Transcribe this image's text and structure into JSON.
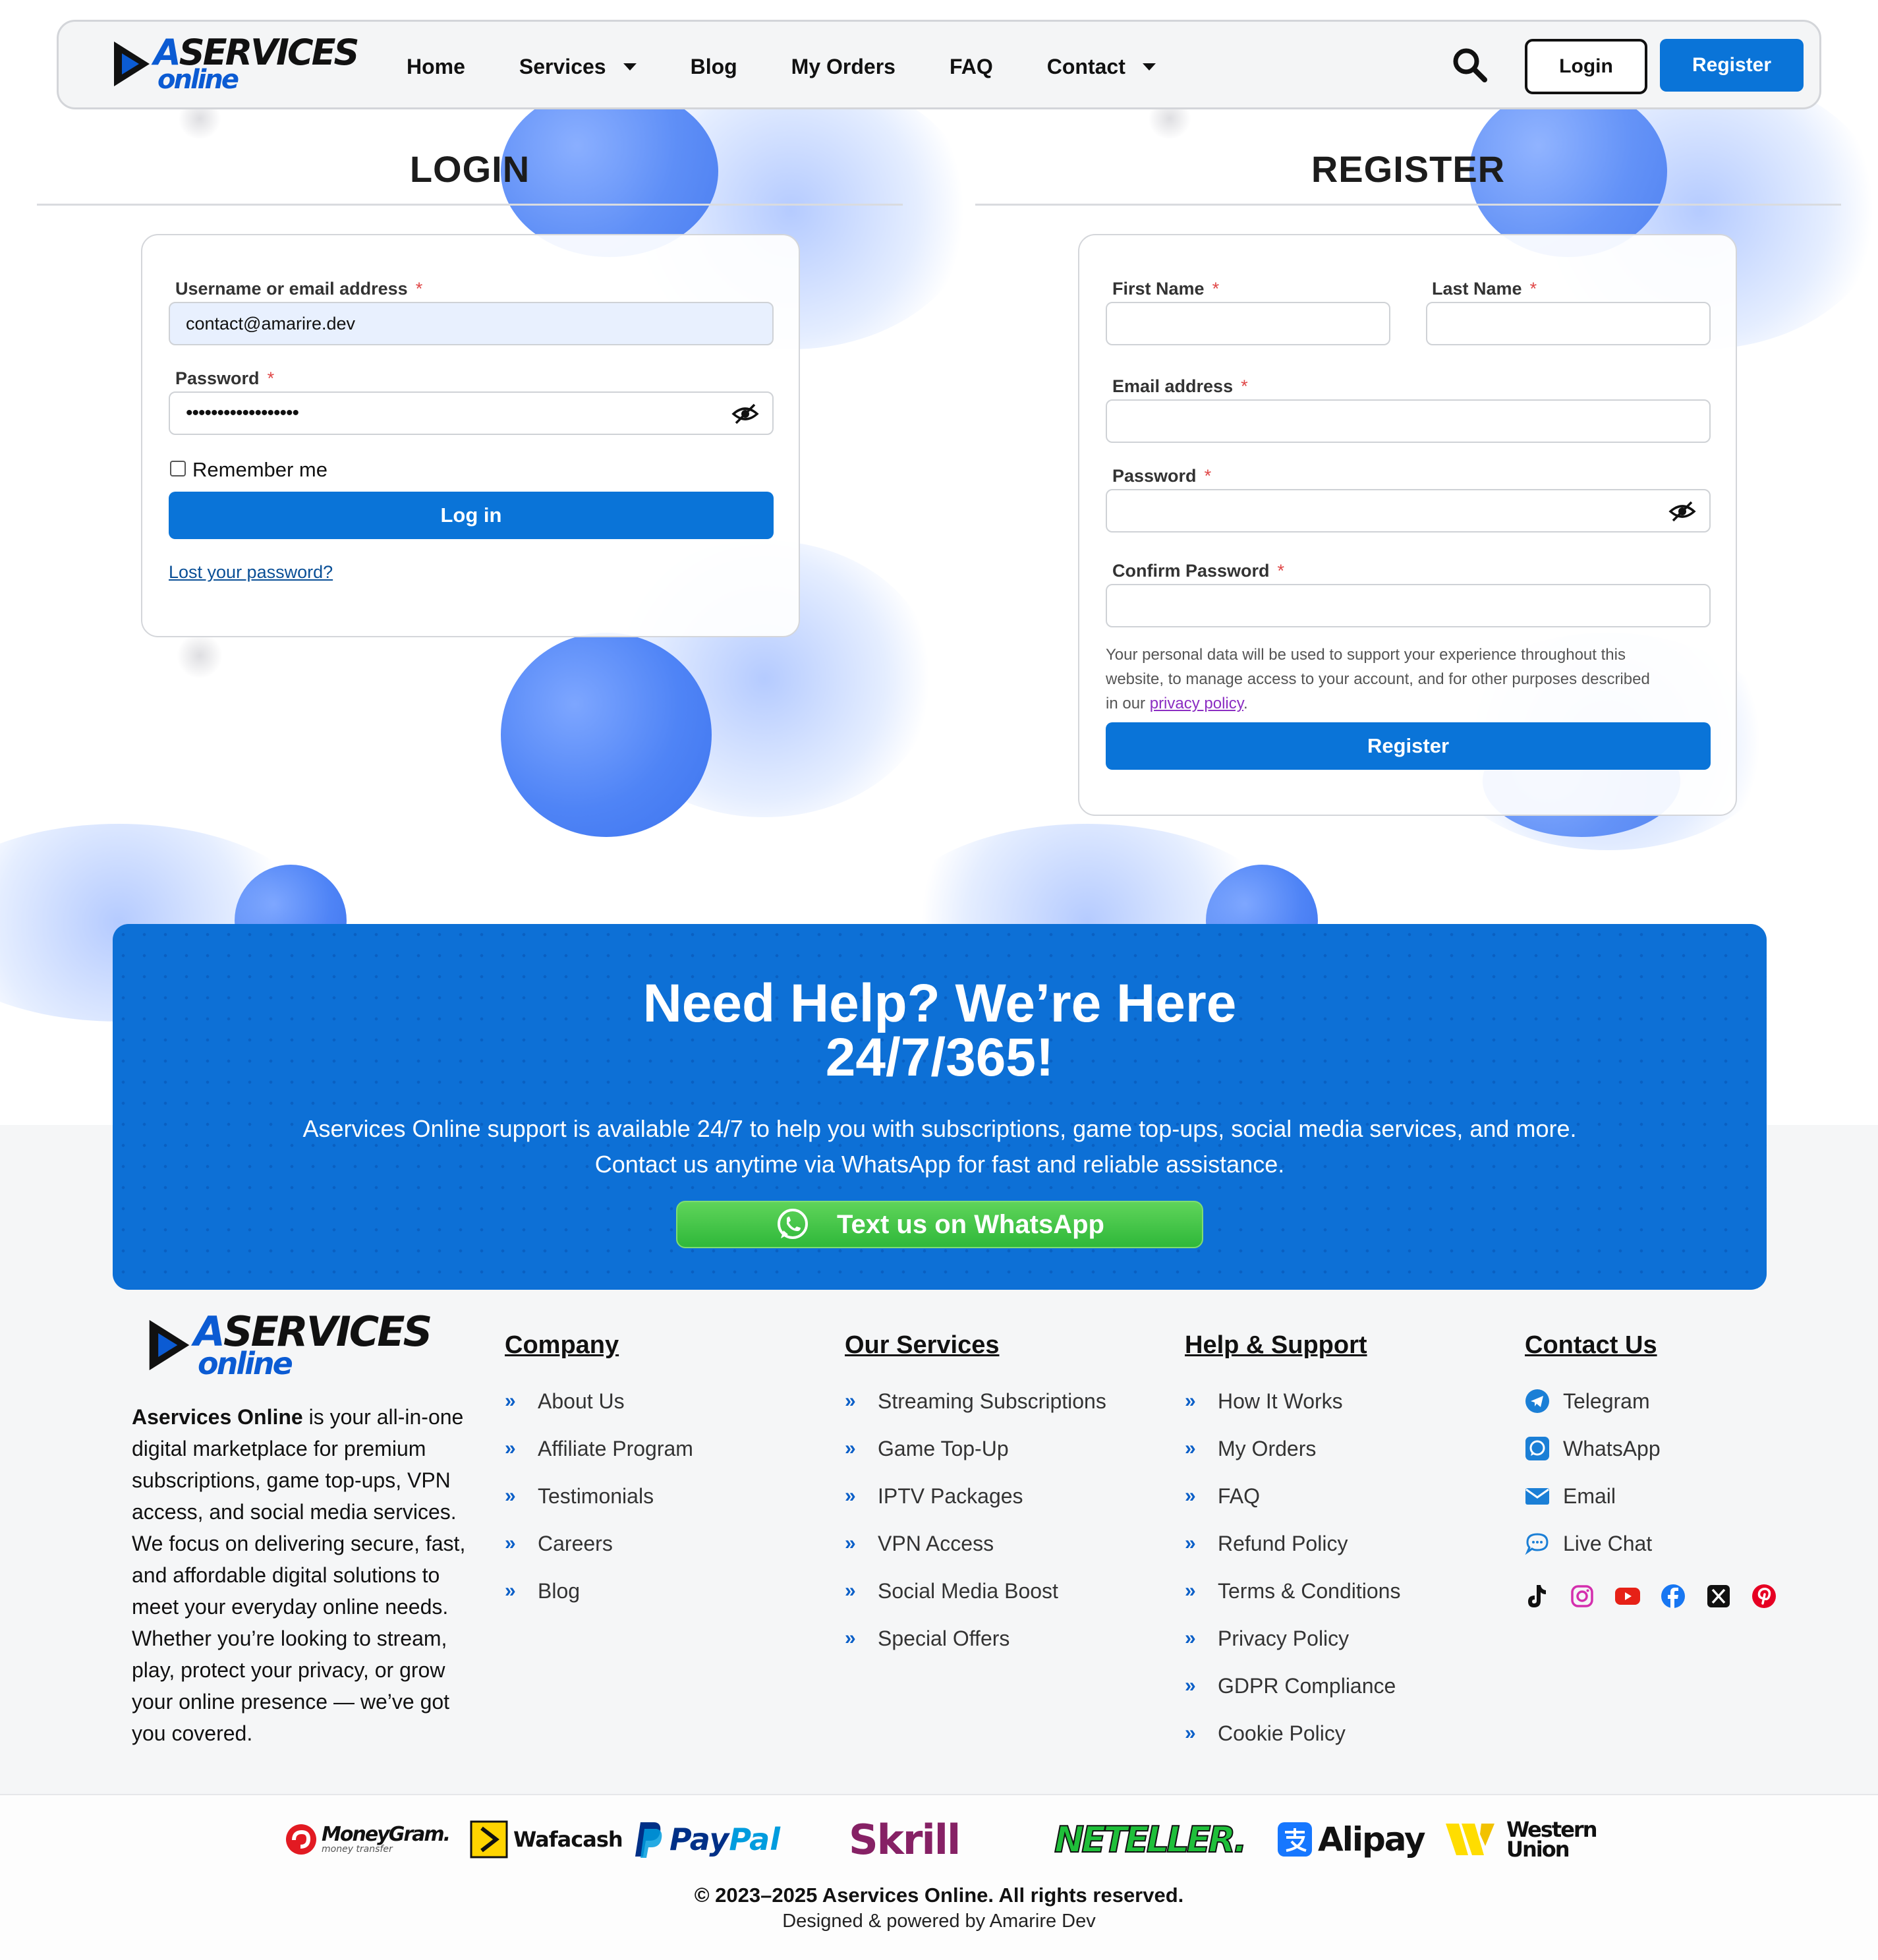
{
  "brand": {
    "logo_top": "SERVICES",
    "logo_initial": "A",
    "logo_bottom": "online",
    "primary_color": "#0a74d8",
    "whatsapp_color": "#3cc24a"
  },
  "header": {
    "nav": [
      {
        "label": "Home"
      },
      {
        "label": "Services"
      },
      {
        "label": "Blog"
      },
      {
        "label": "My Orders"
      },
      {
        "label": "FAQ"
      },
      {
        "label": "Contact"
      }
    ],
    "search_icon": "search-icon",
    "login_label": "Login",
    "register_label": "Register"
  },
  "login": {
    "title": "LOGIN",
    "username_label": "Username or email address",
    "username_value": "contact@amarire.dev",
    "password_label": "Password",
    "password_value": "••••••••••••••••••",
    "remember_label": "Remember me",
    "submit_label": "Log in",
    "lost_password": "Lost your password?"
  },
  "register": {
    "title": "REGISTER",
    "first_name_label": "First Name",
    "last_name_label": "Last Name",
    "email_label": "Email address",
    "password_label": "Password",
    "confirm_label": "Confirm Password",
    "privacy_text_1": "Your personal data will be used to support your experience throughout this",
    "privacy_text_2": "website, to manage access to your account, and for other purposes described",
    "privacy_text_3": "in our",
    "privacy_link": "privacy policy",
    "privacy_text_end": ".",
    "submit_label": "Register",
    "required_mark": "*"
  },
  "help": {
    "title_line1": "Need Help? We’re Here",
    "title_line2": "24/7/365!",
    "text_line1": "Aservices Online support is available 24/7 to help you with subscriptions, game top-ups, social media services, and more.",
    "text_line2": "Contact us anytime via WhatsApp for fast and reliable assistance.",
    "button_label": "Text us on WhatsApp"
  },
  "footer": {
    "about_bold": "Aservices Online",
    "about_text": " is your all-in-one digital marketplace for premium subscriptions, game top-ups, VPN access, and social media services. We focus on delivering secure, fast, and affordable digital solutions to meet your everyday online needs. Whether you’re looking to stream, play, protect your privacy, or grow your online presence — we’ve got you covered.",
    "company": {
      "title": "Company",
      "items": [
        "About Us",
        "Affiliate Program",
        "Testimonials",
        "Careers",
        "Blog"
      ]
    },
    "services": {
      "title": "Our Services",
      "items": [
        "Streaming Subscriptions",
        "Game Top-Up",
        "IPTV Packages",
        "VPN Access",
        "Social Media Boost",
        "Special Offers"
      ]
    },
    "support": {
      "title": "Help & Support",
      "items": [
        "How It Works",
        "My Orders",
        "FAQ",
        "Refund Policy",
        "Terms & Conditions",
        "Privacy Policy",
        "GDPR Compliance",
        "Cookie Policy"
      ]
    },
    "contact": {
      "title": "Contact Us",
      "items": [
        {
          "label": "Telegram",
          "icon": "telegram-icon"
        },
        {
          "label": "WhatsApp",
          "icon": "whatsapp-icon"
        },
        {
          "label": "Email",
          "icon": "email-icon"
        },
        {
          "label": "Live Chat",
          "icon": "chat-icon"
        }
      ],
      "socials": [
        "tiktok-icon",
        "instagram-icon",
        "youtube-icon",
        "facebook-icon",
        "x-icon",
        "pinterest-icon"
      ]
    },
    "payments": {
      "moneygram": "MoneyGram.",
      "moneygram_sub": "money transfer",
      "wafacash": "Wafacash",
      "paypal_a": "Pay",
      "paypal_b": "Pal",
      "skrill": "Skrill",
      "neteller": "NETELLER.",
      "alipay": "Alipay",
      "western_union_1": "Western",
      "western_union_2": "Union"
    },
    "copyright": "© 2023–2025 Aservices Online. All rights reserved.",
    "powered_by": "Designed & powered by Amarire Dev"
  }
}
